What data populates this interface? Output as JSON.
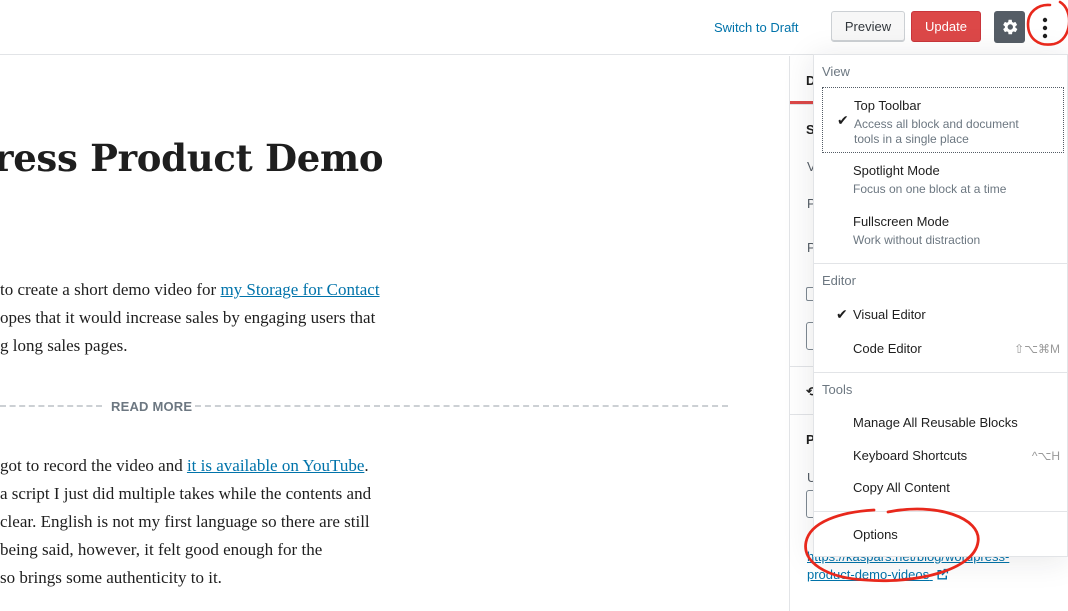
{
  "topbar": {
    "switch_to_draft": "Switch to Draft",
    "preview": "Preview",
    "update": "Update",
    "settings_icon": "gear-icon",
    "more_icon": "vertical-ellipsis-icon"
  },
  "editor": {
    "title": "ress Product Demo",
    "para1": {
      "line1_pre": "to create a short demo video for ",
      "line1_link": "my Storage for Contact ",
      "line2": "opes that it would increase sales by engaging users that",
      "line3": "g long sales pages."
    },
    "read_more": "READ MORE",
    "para2": {
      "line1_pre": " got to record the video and ",
      "line1_link": "it is available on YouTube",
      "line1_post": ".",
      "line2": " a script I just did multiple takes while the contents and",
      "line3": "clear. English is not my first language so there are still",
      "line4": " being said, however, it felt good enough for the",
      "line5": "so brings some authenticity to it."
    }
  },
  "sidebar": {
    "tab_fragment": "D",
    "section_fragments": [
      "S",
      "V",
      "P",
      "P",
      "P",
      "U"
    ],
    "permalink_line1": "https://kaspars.net/blog/wordpress-",
    "permalink_line2": "product-demo-videos",
    "external_icon": "external-link-icon"
  },
  "menu": {
    "view": {
      "label": "View",
      "items": [
        {
          "title": "Top Toolbar",
          "desc": "Access all block and document tools in a single place",
          "desc_line1": "Access all block and document",
          "desc_line2": "tools in a single place",
          "checked": "✔"
        },
        {
          "title": "Spotlight Mode",
          "desc": "Focus on one block at a time"
        },
        {
          "title": "Fullscreen Mode",
          "desc": "Work without distraction"
        }
      ]
    },
    "editor": {
      "label": "Editor",
      "items": [
        {
          "title": "Visual Editor",
          "checked": "✔"
        },
        {
          "title": "Code Editor",
          "shortcut": "⇧⌥⌘M"
        }
      ]
    },
    "tools": {
      "label": "Tools",
      "items": [
        {
          "title": "Manage All Reusable Blocks"
        },
        {
          "title": "Keyboard Shortcuts",
          "shortcut": "^⌥H"
        },
        {
          "title": "Copy All Content"
        }
      ]
    },
    "options": "Options"
  },
  "colors": {
    "accent_link": "#0073aa",
    "update_button": "#dc4848",
    "annotation": "#e8281c"
  }
}
